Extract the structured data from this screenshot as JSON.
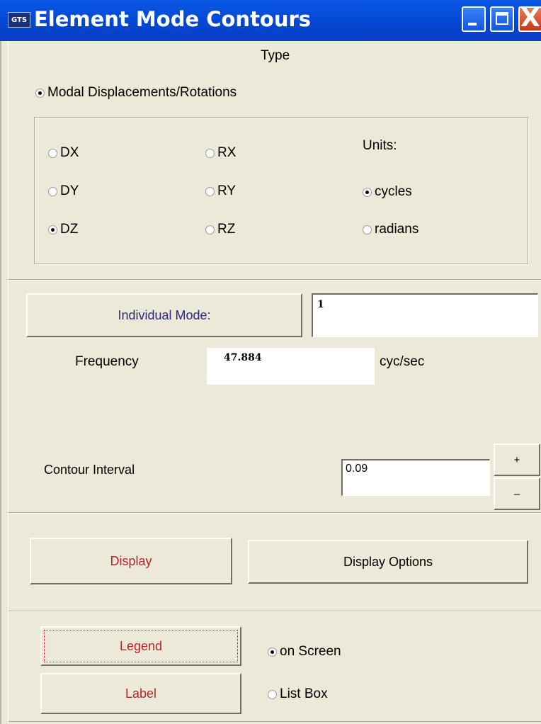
{
  "window": {
    "icon_text": "GTS",
    "title": "Element Mode Contours",
    "close_glyph": "X"
  },
  "type_section": {
    "heading": "Type",
    "mode_option": {
      "label": "Modal Displacements/Rotations",
      "checked": true
    },
    "components": [
      {
        "label": "DX",
        "checked": false
      },
      {
        "label": "DY",
        "checked": false
      },
      {
        "label": "DZ",
        "checked": true
      },
      {
        "label": "RX",
        "checked": false
      },
      {
        "label": "RY",
        "checked": false
      },
      {
        "label": "RZ",
        "checked": false
      }
    ],
    "units": {
      "label": "Units:",
      "options": [
        {
          "label": "cycles",
          "checked": true
        },
        {
          "label": "radians",
          "checked": false
        }
      ]
    }
  },
  "mode_section": {
    "individual_mode_button": "Individual Mode:",
    "individual_mode_value": "1",
    "frequency_label": "Frequency",
    "frequency_value": "47.884",
    "frequency_unit": "cyc/sec",
    "contour_interval_label": "Contour Interval",
    "contour_interval_value": "0.09",
    "increment_label": "+",
    "decrement_label": "–"
  },
  "display_section": {
    "display_button": "Display",
    "display_options_button": "Display Options"
  },
  "legend_section": {
    "legend_button": "Legend",
    "label_button": "Label",
    "options": [
      {
        "label": "on Screen",
        "checked": true
      },
      {
        "label": "List Box",
        "checked": false
      }
    ]
  },
  "colors": {
    "title_bar": "#0347d3",
    "accent_red": "#b8232a",
    "navy_text": "#2b2a7a",
    "dialog_bg": "#ece9d8"
  }
}
